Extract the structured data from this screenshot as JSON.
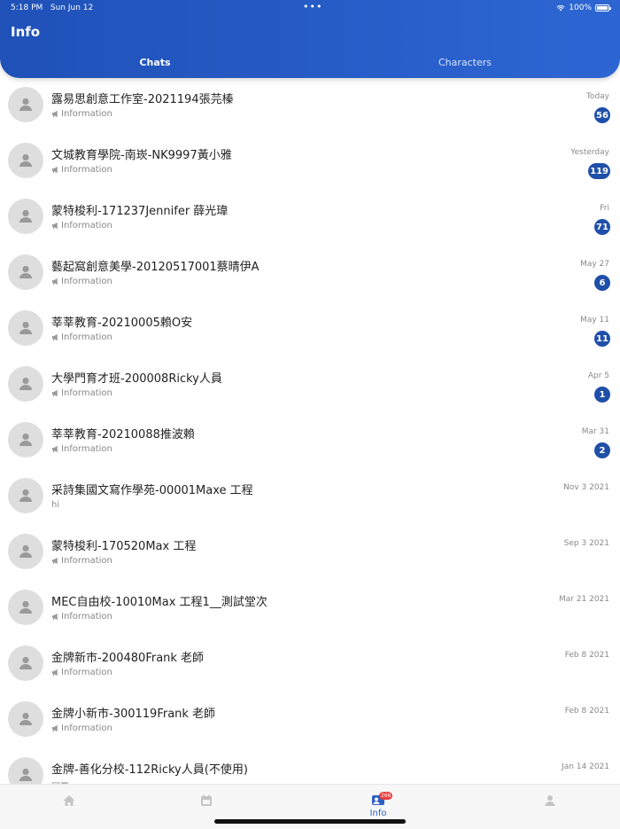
{
  "status_bar": {
    "time": "5:18 PM",
    "date": "Sun Jun 12",
    "dots": "•••",
    "battery": "100%"
  },
  "header": {
    "title": "Info"
  },
  "tabs": [
    {
      "label": "Chats",
      "active": true
    },
    {
      "label": "Characters",
      "active": false
    }
  ],
  "chats": [
    {
      "name": "露易思創意工作室-2021194張芫榛",
      "preview": "Information",
      "preview_icon": "megaphone-icon",
      "time": "Today",
      "badge": "56"
    },
    {
      "name": "文城教育學院-南崁-NK9997黃小雅",
      "preview": "Information",
      "preview_icon": "megaphone-icon",
      "time": "Yesterday",
      "badge": "119"
    },
    {
      "name": "蒙特梭利-171237Jennifer 薛光瑋",
      "preview": "Information",
      "preview_icon": "megaphone-icon",
      "time": "Fri",
      "badge": "71"
    },
    {
      "name": "藝起窩創意美學-20120517001蔡晴伊A",
      "preview": "Information",
      "preview_icon": "megaphone-icon",
      "time": "May 27",
      "badge": "6"
    },
    {
      "name": "莘莘教育-20210005賴O安",
      "preview": "Information",
      "preview_icon": "megaphone-icon",
      "time": "May 11",
      "badge": "11"
    },
    {
      "name": "大學門育才班-200008Ricky人員",
      "preview": "Information",
      "preview_icon": "megaphone-icon",
      "time": "Apr 5",
      "badge": "1"
    },
    {
      "name": "莘莘教育-20210088推波賴",
      "preview": "Information",
      "preview_icon": "megaphone-icon",
      "time": "Mar 31",
      "badge": "2"
    },
    {
      "name": "采詩集國文寫作學苑-00001Maxe 工程",
      "preview": "hi",
      "preview_icon": "",
      "time": "Nov 3 2021",
      "badge": ""
    },
    {
      "name": "蒙特梭利-170520Max 工程",
      "preview": "Information",
      "preview_icon": "megaphone-icon",
      "time": "Sep 3 2021",
      "badge": ""
    },
    {
      "name": "MEC自由校-10010Max  工程1__測試堂次",
      "preview": "Information",
      "preview_icon": "megaphone-icon",
      "time": "Mar 21 2021",
      "badge": ""
    },
    {
      "name": "金牌新市-200480Frank 老師",
      "preview": "Information",
      "preview_icon": "megaphone-icon",
      "time": "Feb 8 2021",
      "badge": ""
    },
    {
      "name": "金牌小新市-300119Frank 老師",
      "preview": "Information",
      "preview_icon": "megaphone-icon",
      "time": "Feb 8 2021",
      "badge": ""
    },
    {
      "name": "金牌-善化分校-112Ricky人員(不使用)",
      "preview": "回覆",
      "preview_icon": "",
      "time": "Jan 14 2021",
      "badge": ""
    }
  ],
  "tabbar": {
    "items": [
      {
        "name": "home",
        "icon": "home-icon",
        "label": ""
      },
      {
        "name": "calendar",
        "icon": "calendar-icon",
        "label": ""
      },
      {
        "name": "info",
        "icon": "chat-info-icon",
        "label": "Info",
        "badge": "266"
      },
      {
        "name": "profile",
        "icon": "person-icon",
        "label": ""
      }
    ]
  },
  "colors": {
    "header": "#2458c4",
    "accent": "#1f4fa8",
    "badge_tab": "#e94040"
  }
}
